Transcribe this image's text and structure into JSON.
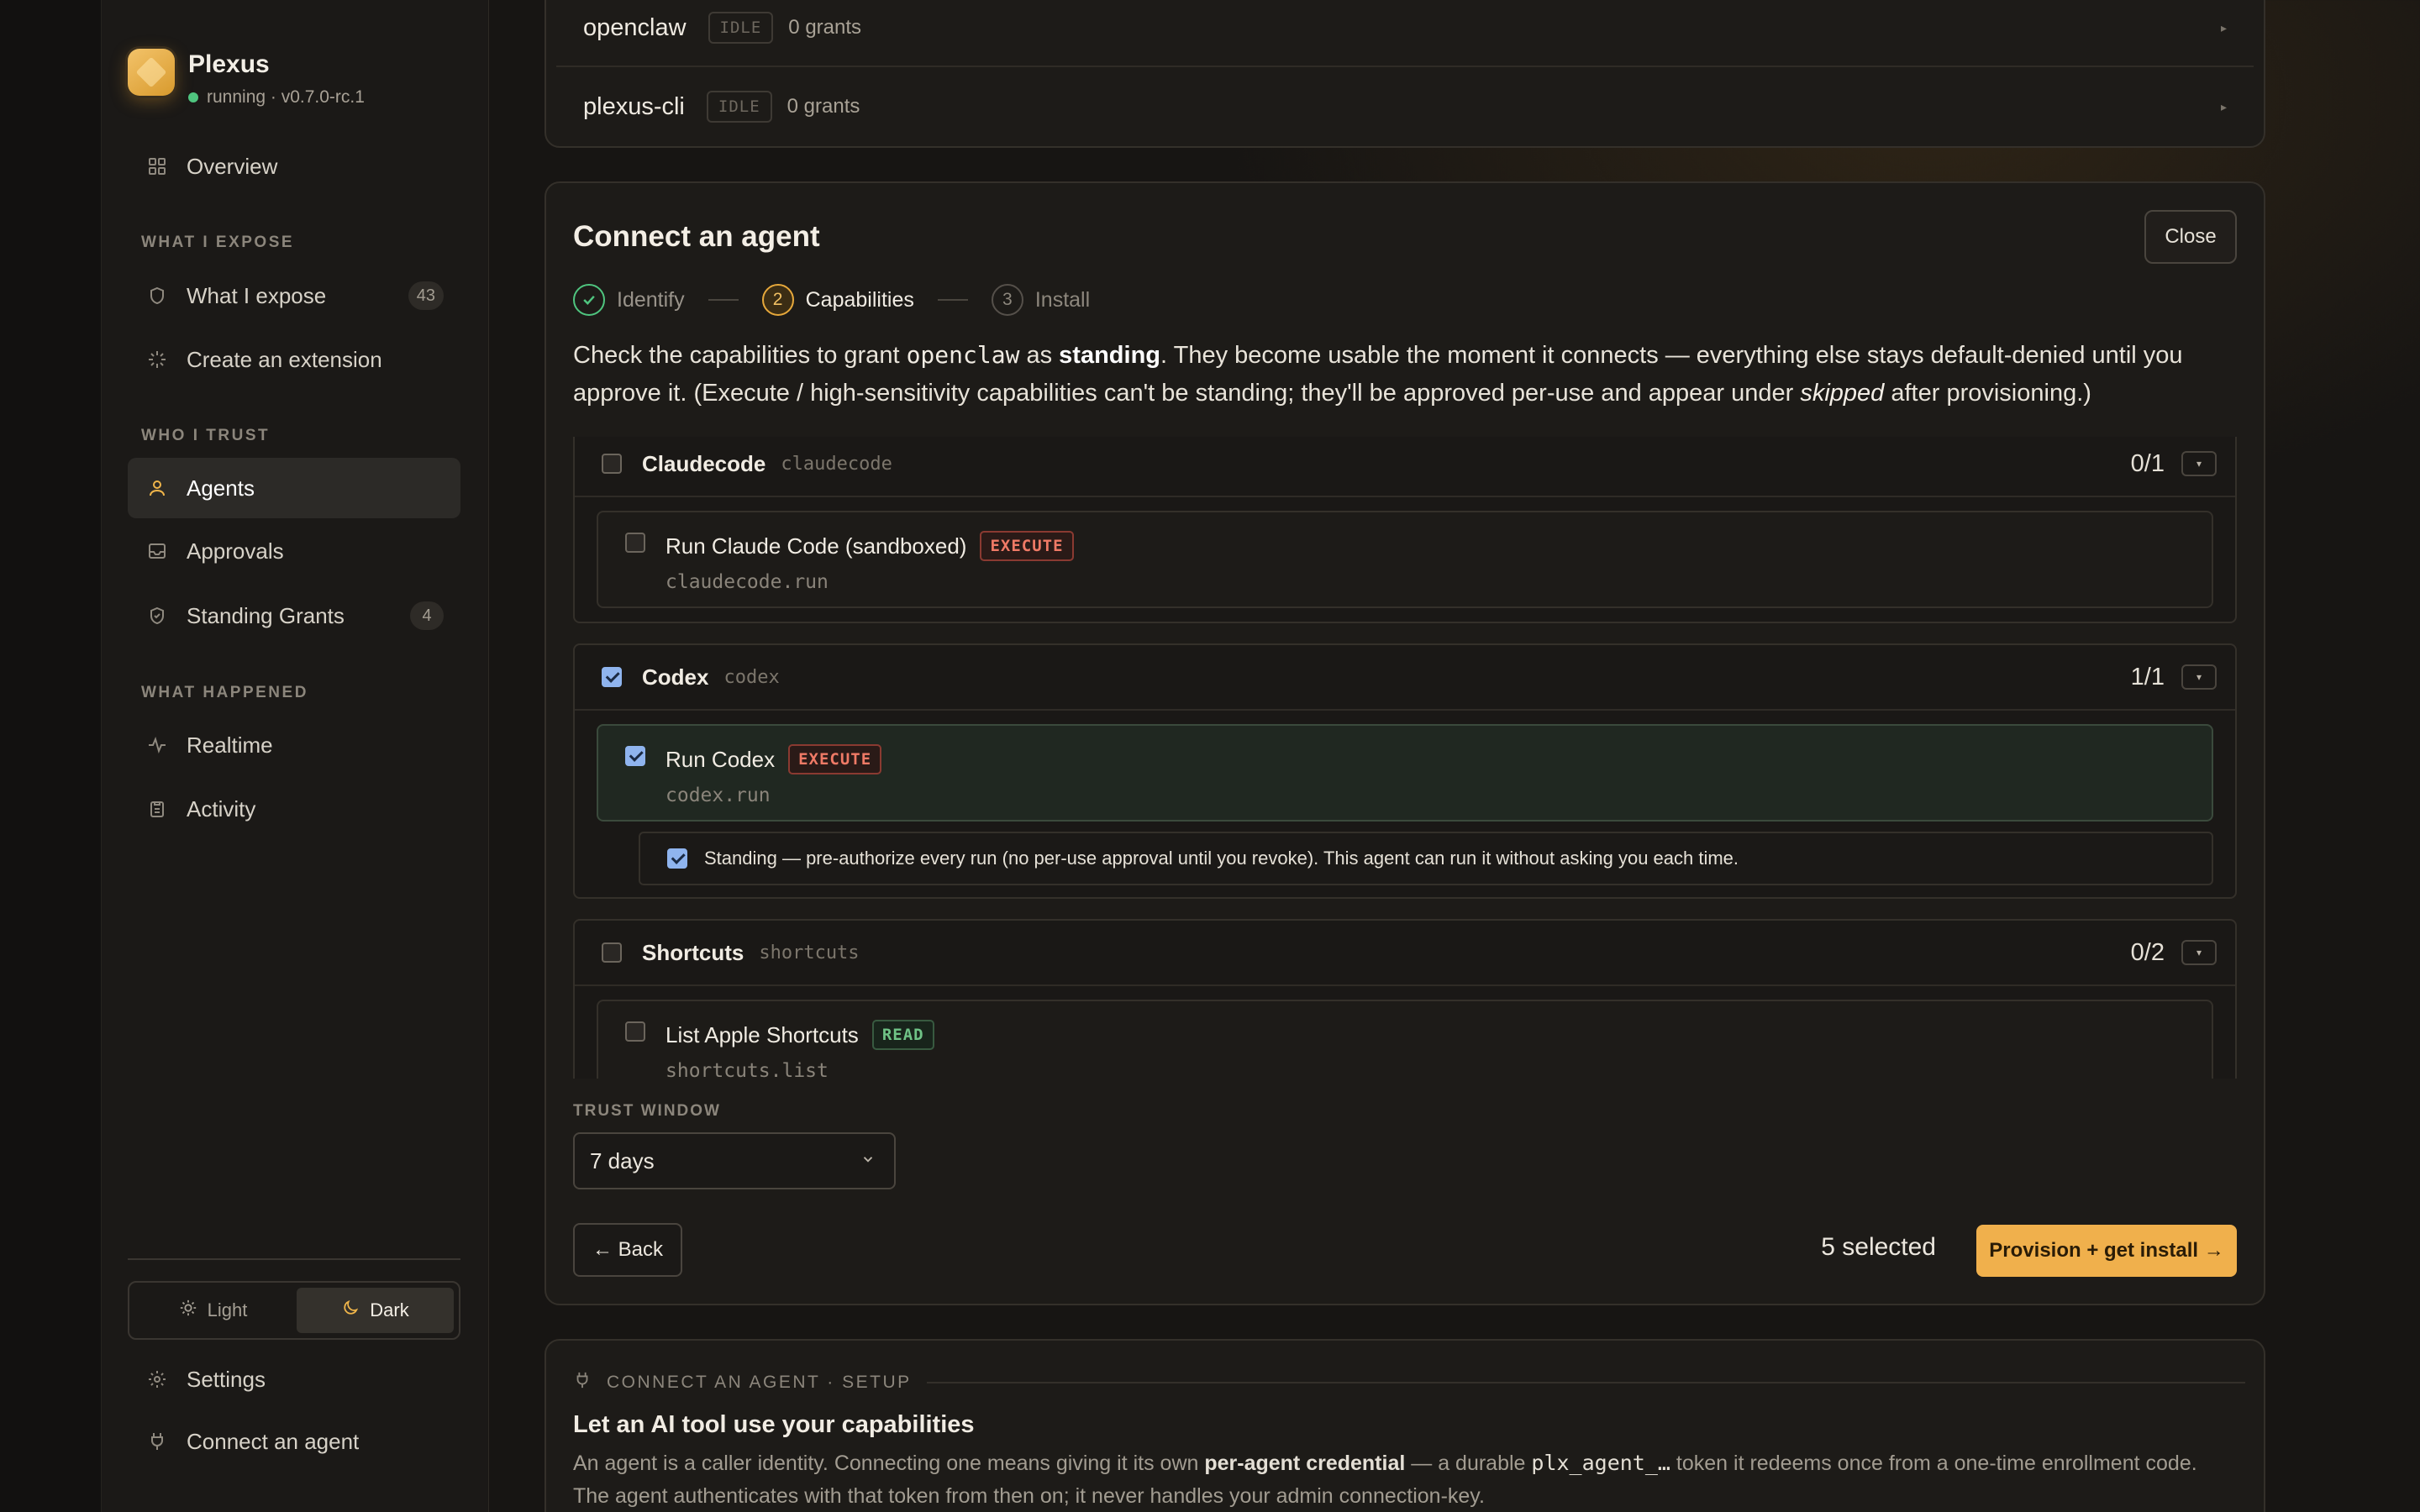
{
  "brand": {
    "name": "Plexus",
    "status": "running · v0.7.0-rc.1"
  },
  "sidebar": {
    "overview": "Overview",
    "section_expose": "WHAT I EXPOSE",
    "what_i_expose": "What I expose",
    "what_i_expose_count": "43",
    "create_extension": "Create an extension",
    "section_trust": "WHO I TRUST",
    "agents": "Agents",
    "approvals": "Approvals",
    "standing_grants": "Standing Grants",
    "standing_grants_count": "4",
    "section_happened": "WHAT HAPPENED",
    "realtime": "Realtime",
    "activity": "Activity",
    "theme_light": "Light",
    "theme_dark": "Dark",
    "settings": "Settings",
    "connect_agent": "Connect an agent"
  },
  "agents": [
    {
      "name": "openclaw",
      "state": "IDLE",
      "grants": "0 grants"
    },
    {
      "name": "plexus-cli",
      "state": "IDLE",
      "grants": "0 grants"
    }
  ],
  "connect": {
    "title": "Connect an agent",
    "close": "Close",
    "steps": [
      {
        "num": "",
        "label": "Identify",
        "status": "done"
      },
      {
        "num": "2",
        "label": "Capabilities",
        "status": "active"
      },
      {
        "num": "3",
        "label": "Install",
        "status": "todo"
      }
    ],
    "intro": {
      "t1": "Check the capabilities to grant ",
      "agent": "openclaw",
      "t2": " as ",
      "standing": "standing",
      "t3": ". They become usable the moment it connects — everything else stays default-denied until you approve it. (Execute / high-sensitivity capabilities can't be standing; they'll be approved per-use and appear under ",
      "skipped": "skipped",
      "t4": " after provisioning.)"
    },
    "groups": [
      {
        "name": "Claudecode",
        "id": "claudecode",
        "count": "0/1",
        "checked": false,
        "caps": [
          {
            "name": "Run Claude Code (sandboxed)",
            "id": "claudecode.run",
            "tag": "EXECUTE",
            "checked": false
          }
        ]
      },
      {
        "name": "Codex",
        "id": "codex",
        "count": "1/1",
        "checked": true,
        "caps": [
          {
            "name": "Run Codex",
            "id": "codex.run",
            "tag": "EXECUTE",
            "checked": true
          }
        ],
        "standing_text": "Standing — pre-authorize every run (no per-use approval until you revoke). This agent can run it without asking you each time."
      },
      {
        "name": "Shortcuts",
        "id": "shortcuts",
        "count": "0/2",
        "checked": false,
        "caps": [
          {
            "name": "List Apple Shortcuts",
            "id": "shortcuts.list",
            "tag": "READ",
            "checked": false
          }
        ]
      }
    ],
    "trust_window_label": "TRUST WINDOW",
    "trust_window_value": "7 days",
    "back": "← Back",
    "selected": "5 selected",
    "provision": "Provision + get install →"
  },
  "setup": {
    "kicker": "CONNECT AN AGENT · SETUP",
    "title": "Let an AI tool use your capabilities",
    "b1": "An agent is a caller identity. Connecting one means giving it its own ",
    "b_bold": "per-agent credential",
    "b2": " — a durable ",
    "b_code": "plx_agent_…",
    "b3": " token it redeems once from a one-time enrollment code. The agent authenticates with that token from then on; it never handles your admin connection-key."
  },
  "colors": {
    "accent": "#f0b04c",
    "success": "#4fc57f",
    "execute": "#ef7a66",
    "read": "#6fc386",
    "checkbox": "#8fb4ee"
  }
}
